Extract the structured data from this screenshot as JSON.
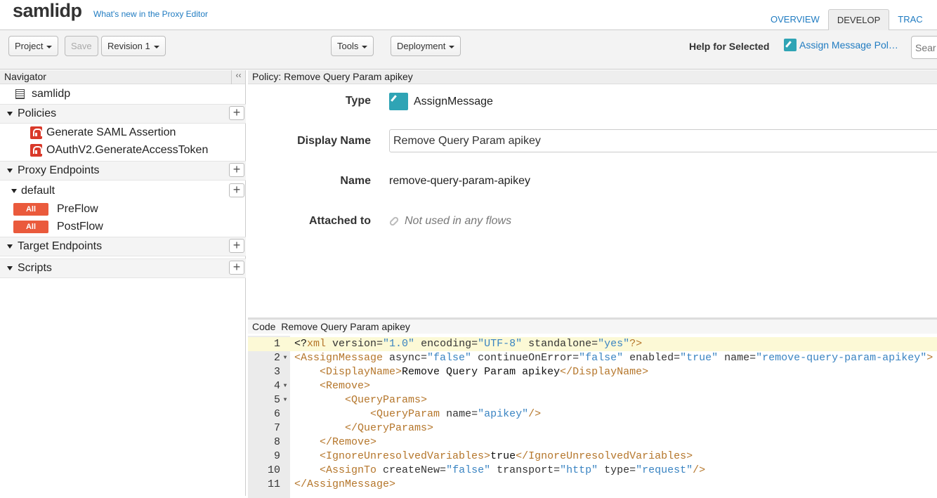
{
  "header": {
    "app_title": "samlidp",
    "whats_new": "What's new in the Proxy Editor",
    "tabs": [
      "OVERVIEW",
      "DEVELOP",
      "TRAC"
    ]
  },
  "toolbar": {
    "project": "Project",
    "save": "Save",
    "revision": "Revision 1",
    "tools": "Tools",
    "deployment": "Deployment",
    "help_label": "Help for Selected",
    "help_link": "Assign Message Pol…",
    "search_placeholder": "Sear"
  },
  "navigator": {
    "header": "Navigator",
    "collapse": "‹‹",
    "root": "samlidp",
    "policies_label": "Policies",
    "policies": [
      "Generate SAML Assertion",
      "OAuthV2.GenerateAccessToken"
    ],
    "proxy_endpoints_label": "Proxy Endpoints",
    "default_label": "default",
    "all_badge": "All",
    "flows": [
      "PreFlow",
      "PostFlow"
    ],
    "target_endpoints_label": "Target Endpoints",
    "scripts_label": "Scripts"
  },
  "policy": {
    "header": "Policy: Remove Query Param apikey",
    "type_label": "Type",
    "type_value": "AssignMessage",
    "display_name_label": "Display Name",
    "display_name_value": "Remove Query Param apikey",
    "name_label": "Name",
    "name_value": "remove-query-param-apikey",
    "attached_label": "Attached to",
    "attached_value": "Not used in any flows"
  },
  "code": {
    "header_code": "Code",
    "header_name": "Remove Query Param apikey",
    "lines": [
      {
        "n": "1",
        "fold": ""
      },
      {
        "n": "2",
        "fold": "▼"
      },
      {
        "n": "3",
        "fold": ""
      },
      {
        "n": "4",
        "fold": "▼"
      },
      {
        "n": "5",
        "fold": "▼"
      },
      {
        "n": "6",
        "fold": ""
      },
      {
        "n": "7",
        "fold": ""
      },
      {
        "n": "8",
        "fold": ""
      },
      {
        "n": "9",
        "fold": ""
      },
      {
        "n": "10",
        "fold": ""
      },
      {
        "n": "11",
        "fold": ""
      }
    ],
    "tokens": {
      "l1": [
        "<?",
        "xml",
        " version=",
        "\"1.0\"",
        " encoding=",
        "\"UTF-8\"",
        " standalone=",
        "\"yes\"",
        "?>"
      ],
      "l2": [
        "<AssignMessage",
        " async=",
        "\"false\"",
        " continueOnError=",
        "\"false\"",
        " enabled=",
        "\"true\"",
        " name=",
        "\"remove-query-param-apikey\"",
        ">"
      ],
      "l3": [
        "    ",
        "<DisplayName>",
        "Remove Query Param apikey",
        "</DisplayName>"
      ],
      "l4": [
        "    ",
        "<Remove>"
      ],
      "l5": [
        "        ",
        "<QueryParams>"
      ],
      "l6": [
        "            ",
        "<QueryParam",
        " name=",
        "\"apikey\"",
        "/>"
      ],
      "l7": [
        "        ",
        "</QueryParams>"
      ],
      "l8": [
        "    ",
        "</Remove>"
      ],
      "l9": [
        "    ",
        "<IgnoreUnresolvedVariables>",
        "true",
        "</IgnoreUnresolvedVariables>"
      ],
      "l10": [
        "    ",
        "<AssignTo",
        " createNew=",
        "\"false\"",
        " transport=",
        "\"http\"",
        " type=",
        "\"request\"",
        "/>"
      ],
      "l11": [
        "",
        "</AssignMessage>"
      ]
    }
  },
  "colors": {
    "link": "#1f7bc1",
    "accent_teal": "#2fa4b5",
    "lock_red": "#d9392a",
    "badge_orange": "#ea5a3c",
    "xml_tag": "#b5762b",
    "xml_string": "#3a84c2"
  },
  "icons": {
    "policy_type": "edit-icon",
    "policy_lock": "lock-icon",
    "attached": "link-icon",
    "root_doc": "document-icon"
  }
}
